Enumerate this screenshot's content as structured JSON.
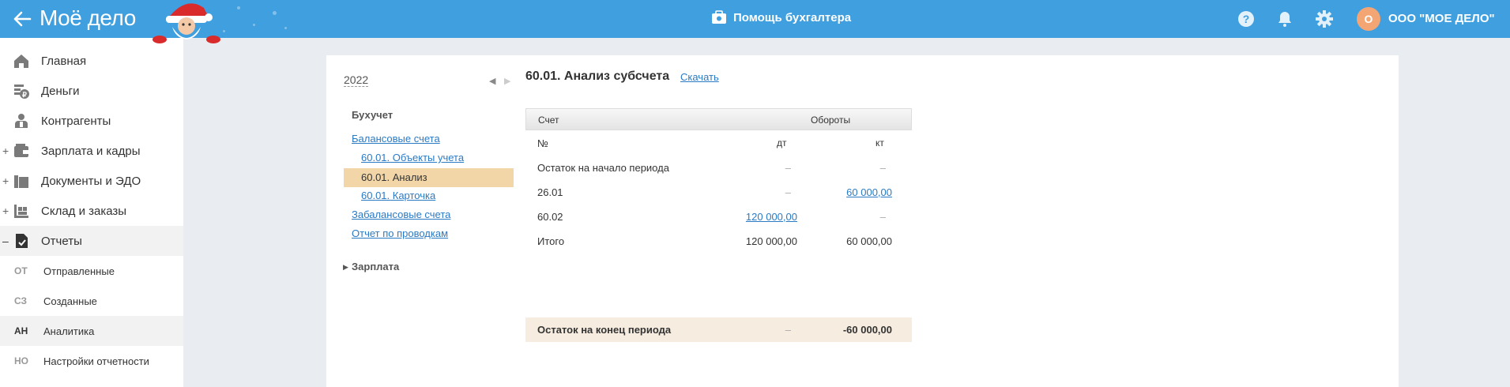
{
  "header": {
    "logo": "Моё дело",
    "help_center": "Помощь бухгалтера",
    "avatar_letter": "О",
    "company": "ООО \"МОЕ ДЕЛО\""
  },
  "sidebar": {
    "items": [
      {
        "label": "Главная",
        "icon": "home-icon",
        "expand": ""
      },
      {
        "label": "Деньги",
        "icon": "money-icon",
        "expand": ""
      },
      {
        "label": "Контрагенты",
        "icon": "contractor-icon",
        "expand": ""
      },
      {
        "label": "Зарплата и кадры",
        "icon": "wallet-icon",
        "expand": "+"
      },
      {
        "label": "Документы и ЭДО",
        "icon": "folder-icon",
        "expand": "+"
      },
      {
        "label": "Склад и заказы",
        "icon": "warehouse-icon",
        "expand": "+"
      },
      {
        "label": "Отчеты",
        "icon": "report-icon",
        "expand": "–"
      }
    ],
    "subitems": [
      {
        "abbr": "ОТ",
        "label": "Отправленные"
      },
      {
        "abbr": "СЗ",
        "label": "Созданные"
      },
      {
        "abbr": "АН",
        "label": "Аналитика"
      },
      {
        "abbr": "НО",
        "label": "Настройки отчетности"
      }
    ]
  },
  "tree": {
    "year": "2022",
    "section1": "Бухучет",
    "links": [
      "Балансовые счета",
      "60.01. Объекты учета",
      "60.01. Анализ",
      "60.01. Карточка",
      "Забалансовые счета",
      "Отчет по проводкам"
    ],
    "section2": "Зарплата"
  },
  "report": {
    "title": "60.01. Анализ субсчета",
    "download": "Скачать",
    "col_account": "Счет",
    "col_turnover": "Обороты",
    "col_no": "№",
    "col_dt": "дт",
    "col_kt": "кт",
    "rows": [
      {
        "name": "Остаток на начало периода",
        "dt": "–",
        "kt": "–"
      },
      {
        "name": "26.01",
        "dt": "–",
        "kt": "60 000,00"
      },
      {
        "name": "60.02",
        "dt": "120 000,00",
        "kt": "–"
      },
      {
        "name": "Итого",
        "dt": "120 000,00",
        "kt": "60 000,00"
      }
    ],
    "total": {
      "name": "Остаток на конец периода",
      "dt": "–",
      "kt": "-60 000,00"
    }
  }
}
